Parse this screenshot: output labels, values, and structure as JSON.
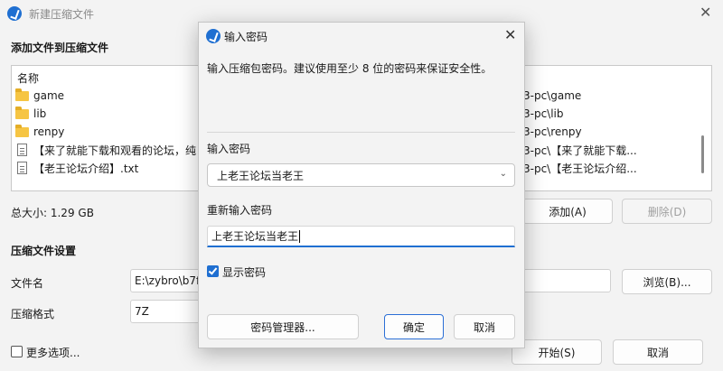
{
  "main_window": {
    "title": "新建压缩文件",
    "section_add_files": "添加文件到压缩文件",
    "list_header": "名称",
    "files": [
      {
        "icon": "folder-icon",
        "name": "game",
        "path": "3-pc\\game"
      },
      {
        "icon": "folder-icon",
        "name": "lib",
        "path": "3-pc\\lib"
      },
      {
        "icon": "folder-icon",
        "name": "renpy",
        "path": "3-pc\\renpy"
      },
      {
        "icon": "file-icon",
        "name": "【来了就能下载和观看的论坛，纯",
        "path": "3-pc\\【来了就能下载..."
      },
      {
        "icon": "file-icon",
        "name": "【老王论坛介绍】.txt",
        "path": "3-pc\\【老王论坛介绍..."
      }
    ],
    "total_size": "总大小: 1.29 GB",
    "add_button": "添加(A)",
    "remove_button": "删除(D)",
    "section_settings": "压缩文件设置",
    "file_name_label": "文件名",
    "file_name_value": "E:\\zybro\\b7f",
    "browse_button": "浏览(B)...",
    "format_label": "压缩格式",
    "format_value": "7Z",
    "more_options": "更多选项...",
    "start_button": "开始(S)",
    "cancel_button": "取消"
  },
  "dialog": {
    "title": "输入密码",
    "instruction": "输入压缩包密码。建议使用至少 8 位的密码来保证安全性。",
    "password_label": "输入密码",
    "password_value": "上老王论坛当老王",
    "reenter_label": "重新输入密码",
    "reenter_value": "上老王论坛当老王",
    "show_password_label": "显示密码",
    "show_password_checked": true,
    "manager_button": "密码管理器...",
    "ok_button": "确定",
    "cancel_button": "取消"
  },
  "colors": {
    "accent": "#1f6fd1",
    "background": "#f3f3f3",
    "folder": "#f6c543"
  }
}
